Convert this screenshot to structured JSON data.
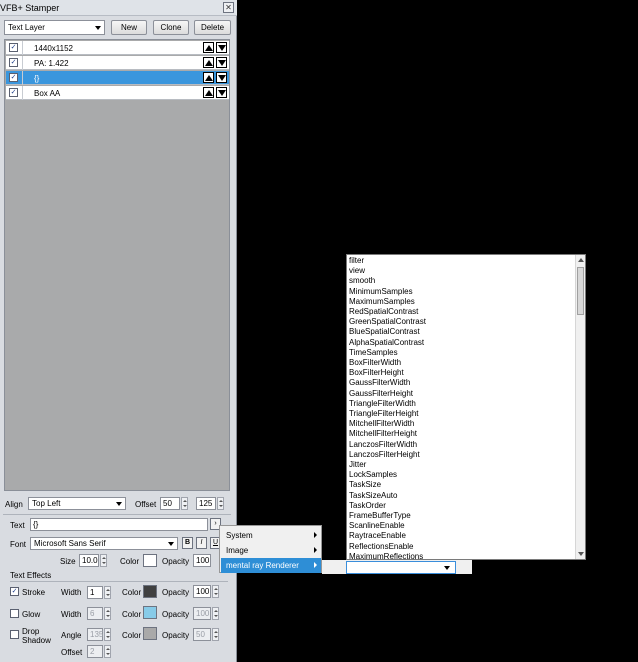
{
  "window": {
    "title": "VFB+ Stamper",
    "close_glyph": "✕"
  },
  "toolbar": {
    "layer_type": "Text Layer",
    "new_label": "New",
    "clone_label": "Clone",
    "delete_label": "Delete"
  },
  "layers": [
    {
      "label": "1440x1152",
      "checked": true,
      "selected": false
    },
    {
      "label": "PA: 1.422",
      "checked": true,
      "selected": false
    },
    {
      "label": "{}",
      "checked": true,
      "selected": true
    },
    {
      "label": "Box AA",
      "checked": true,
      "selected": false
    }
  ],
  "align": {
    "label": "Align",
    "value": "Top Left",
    "offset_label": "Offset",
    "offset_x": "50",
    "offset_y": "125"
  },
  "text": {
    "label": "Text",
    "value": "{}",
    "font_label": "Font",
    "font_value": "Microsoft Sans Serif",
    "bold": "B",
    "italic": "I",
    "underline": "U",
    "size_label": "Size",
    "size_value": "10.0",
    "color_label": "Color",
    "opacity_label": "Opacity",
    "opacity_value": "100"
  },
  "effects": {
    "header": "Text Effects",
    "stroke": {
      "label": "Stroke",
      "checked": true,
      "width_label": "Width",
      "width": "1",
      "color_label": "Color",
      "color": "#404040",
      "opacity_label": "Opacity",
      "opacity": "100"
    },
    "glow": {
      "label": "Glow",
      "checked": false,
      "width_label": "Width",
      "width": "6",
      "color_label": "Color",
      "color": "#87cbe8",
      "opacity_label": "Opacity",
      "opacity": "100"
    },
    "drop": {
      "label": "Drop Shadow",
      "line1": "Drop",
      "line2": "Shadow",
      "checked": false,
      "angle_label": "Angle",
      "angle": "135",
      "color_label": "Color",
      "color": "#a9a9a9",
      "opacity_label": "Opacity",
      "opacity": "50",
      "offset_label": "Offset",
      "offset": "2"
    }
  },
  "menu": {
    "items": [
      {
        "label": "System",
        "highlighted": false
      },
      {
        "label": "Image",
        "highlighted": false
      },
      {
        "label": "mental ray Renderer",
        "highlighted": true
      }
    ]
  },
  "dropdown": {
    "items": [
      "filter",
      "view",
      "smooth",
      "MinimumSamples",
      "MaximumSamples",
      "RedSpatialContrast",
      "GreenSpatialContrast",
      "BlueSpatialContrast",
      "AlphaSpatialContrast",
      "TimeSamples",
      "BoxFilterWidth",
      "BoxFilterHeight",
      "GaussFilterWidth",
      "GaussFilterHeight",
      "TriangleFilterWidth",
      "TriangleFilterHeight",
      "MitchellFilterWidth",
      "MitchellFilterHeight",
      "LanczosFilterWidth",
      "LanczosFilterHeight",
      "Jitter",
      "LockSamples",
      "TaskSize",
      "TaskSizeAuto",
      "TaskOrder",
      "FrameBufferType",
      "ScanlineEnable",
      "RaytraceEnable",
      "ReflectionsEnable",
      "MaximumReflections"
    ]
  },
  "colors": {
    "selection": "#3a96dd",
    "menu_highlight": "#2e8ed6",
    "text_color_swatch": "#ffffff"
  }
}
